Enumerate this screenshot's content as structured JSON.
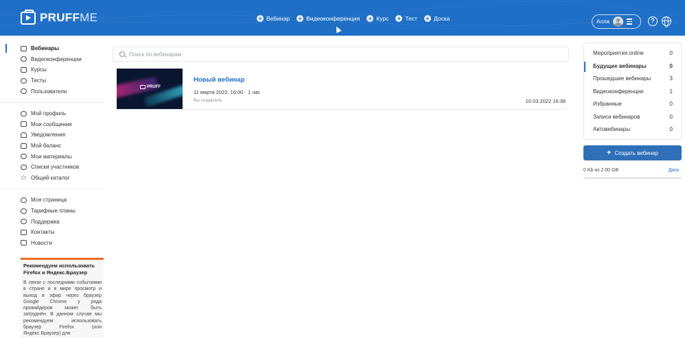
{
  "header": {
    "logo_text": "PRUFF",
    "logo_text_thin": "ME",
    "create_items": [
      {
        "label": "Вебинар"
      },
      {
        "label": "Видеоконференция"
      },
      {
        "label": "Курс"
      },
      {
        "label": "Тест"
      },
      {
        "label": "Доска"
      }
    ],
    "user_name": "Алла"
  },
  "search": {
    "placeholder": "Поиск по вебинарам"
  },
  "sidebar": {
    "group1": [
      {
        "label": "Вебинары",
        "icon": "webinar-icon"
      },
      {
        "label": "Видеоконференции",
        "icon": "broadcast-icon"
      },
      {
        "label": "Курсы",
        "icon": "courses-icon"
      },
      {
        "label": "Тесты",
        "icon": "tests-icon"
      },
      {
        "label": "Пользователи",
        "icon": "users-icon"
      }
    ],
    "group2": [
      {
        "label": "Мой профиль",
        "icon": "profile-gear-icon"
      },
      {
        "label": "Мои сообщения",
        "icon": "messages-icon"
      },
      {
        "label": "Уведомления",
        "icon": "bell-icon"
      },
      {
        "label": "Мой баланс",
        "icon": "wallet-icon"
      },
      {
        "label": "Мои материалы",
        "icon": "materials-icon"
      },
      {
        "label": "Списки участников",
        "icon": "participants-icon"
      },
      {
        "label": "Общий каталог",
        "icon": "star-icon"
      }
    ],
    "group3": [
      {
        "label": "Моя страница",
        "icon": "my-page-icon"
      },
      {
        "label": "Тарифные планы",
        "icon": "plans-icon"
      },
      {
        "label": "Поддержка",
        "icon": "headset-icon"
      },
      {
        "label": "Контакты",
        "icon": "contacts-icon"
      },
      {
        "label": "Новости",
        "icon": "megaphone-icon"
      }
    ],
    "notice": {
      "title": "Рекомендуем использовать Firefox и Яндекс.Браузер",
      "text": "В связи с последними событиями в стране и в мире просмотр и выход в эфир через браузер Google Chrome у ряда провайдеров может быть затруднён. В данном случае мы рекомендуем использовать браузер Firefox (или Яндекс.Браузер) для"
    }
  },
  "webinar": {
    "thumb_logo": "PRUFF",
    "title": "Новый вебинар",
    "date": "11 марта 2022, 16:00 · 1 час",
    "creator": "Вы создатель",
    "stamp": "10.03.2022 16:38"
  },
  "right_panel": {
    "rows": [
      {
        "label": "Мероприятия online",
        "count": "0"
      },
      {
        "label": "Будущие вебинары",
        "count": "0"
      },
      {
        "label": "Прошедшие вебинары",
        "count": "3"
      },
      {
        "label": "Видеоконференции",
        "count": "1"
      },
      {
        "label": "Избранные",
        "count": "0"
      },
      {
        "label": "Записи вебинаров",
        "count": "0"
      },
      {
        "label": "Автовебинары",
        "count": "0"
      }
    ],
    "create_button": "Создать вебинар",
    "disk_usage": "0 Kb из 2.00 GB",
    "disk_link": "Диск",
    "disk_used_fraction": 0.0
  }
}
